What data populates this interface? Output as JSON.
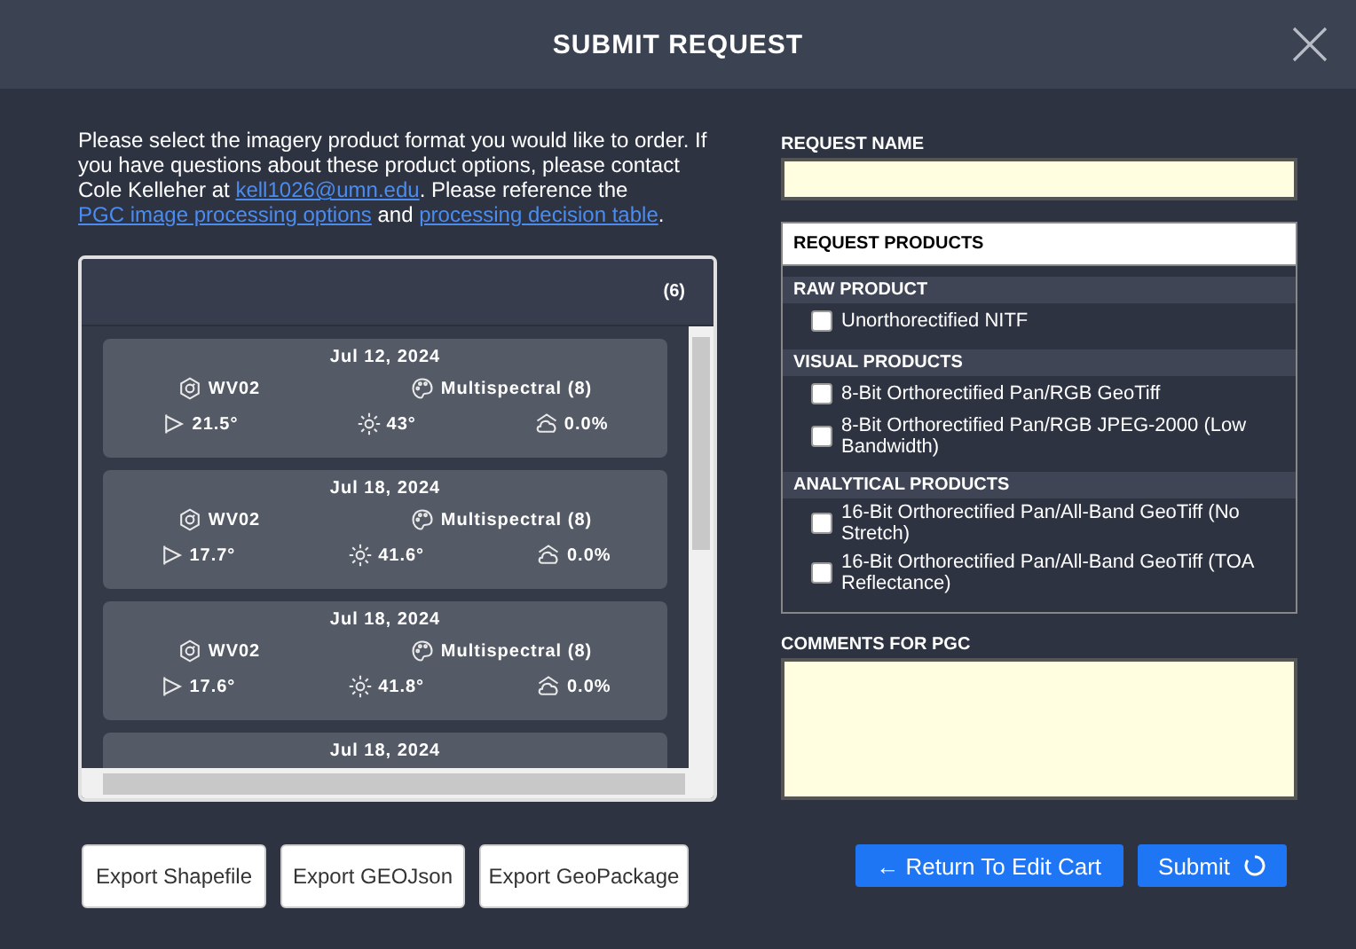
{
  "window": {
    "title": "SUBMIT REQUEST"
  },
  "intro": [
    {
      "kind": "text",
      "text": "Please select the imagery product format you would like to order. If you have questions about these product options, please contact Cole Kelleher at "
    },
    {
      "kind": "link",
      "text": "kell1026@umn.edu"
    },
    {
      "kind": "text",
      "text": ". Please reference the "
    },
    {
      "kind": "link",
      "text": "PGC image processing options"
    },
    {
      "kind": "text",
      "text": " and "
    },
    {
      "kind": "link",
      "text": "processing decision table"
    },
    {
      "kind": "text",
      "text": "."
    }
  ],
  "scene_list": {
    "count": "(6)",
    "items": [
      {
        "date": "Jul 12, 2024",
        "satellite": "WV02",
        "sensor": "Multispectral (8)",
        "off_nadir": "21.5°",
        "sun_elevation": "43°",
        "cloud_cover": "0.0%"
      },
      {
        "date": "Jul 18, 2024",
        "satellite": "WV02",
        "sensor": "Multispectral (8)",
        "off_nadir": "17.7°",
        "sun_elevation": "41.6°",
        "cloud_cover": "0.0%"
      },
      {
        "date": "Jul 18, 2024",
        "satellite": "WV02",
        "sensor": "Multispectral (8)",
        "off_nadir": "17.6°",
        "sun_elevation": "41.8°",
        "cloud_cover": "0.0%"
      },
      {
        "date": "Jul 18, 2024"
      }
    ]
  },
  "export_buttons": [
    "Export Shapefile",
    "Export GEOJson",
    "Export GeoPackage"
  ],
  "request_name": {
    "label": "REQUEST NAME"
  },
  "request_products": {
    "title": "REQUEST PRODUCTS",
    "groups": [
      {
        "name": "RAW PRODUCT",
        "items": [
          {
            "label": "Unorthorectified NITF",
            "checked": false
          }
        ]
      },
      {
        "name": "VISUAL PRODUCTS",
        "items": [
          {
            "label": "8-Bit Orthorectified Pan/RGB GeoTiff",
            "checked": false
          },
          {
            "label": "8-Bit Orthorectified Pan/RGB JPEG-2000 (Low Bandwidth)",
            "checked": false
          }
        ]
      },
      {
        "name": "ANALYTICAL PRODUCTS",
        "items": [
          {
            "label": "16-Bit Orthorectified Pan/All-Band GeoTiff (No Stretch)",
            "checked": false
          },
          {
            "label": "16-Bit Orthorectified Pan/All-Band GeoTiff (TOA Reflectance)",
            "checked": false
          }
        ]
      }
    ]
  },
  "comments": {
    "label": "COMMENTS FOR PGC"
  },
  "actions": {
    "back": "← Return To Edit Cart",
    "submit": "Submit"
  }
}
